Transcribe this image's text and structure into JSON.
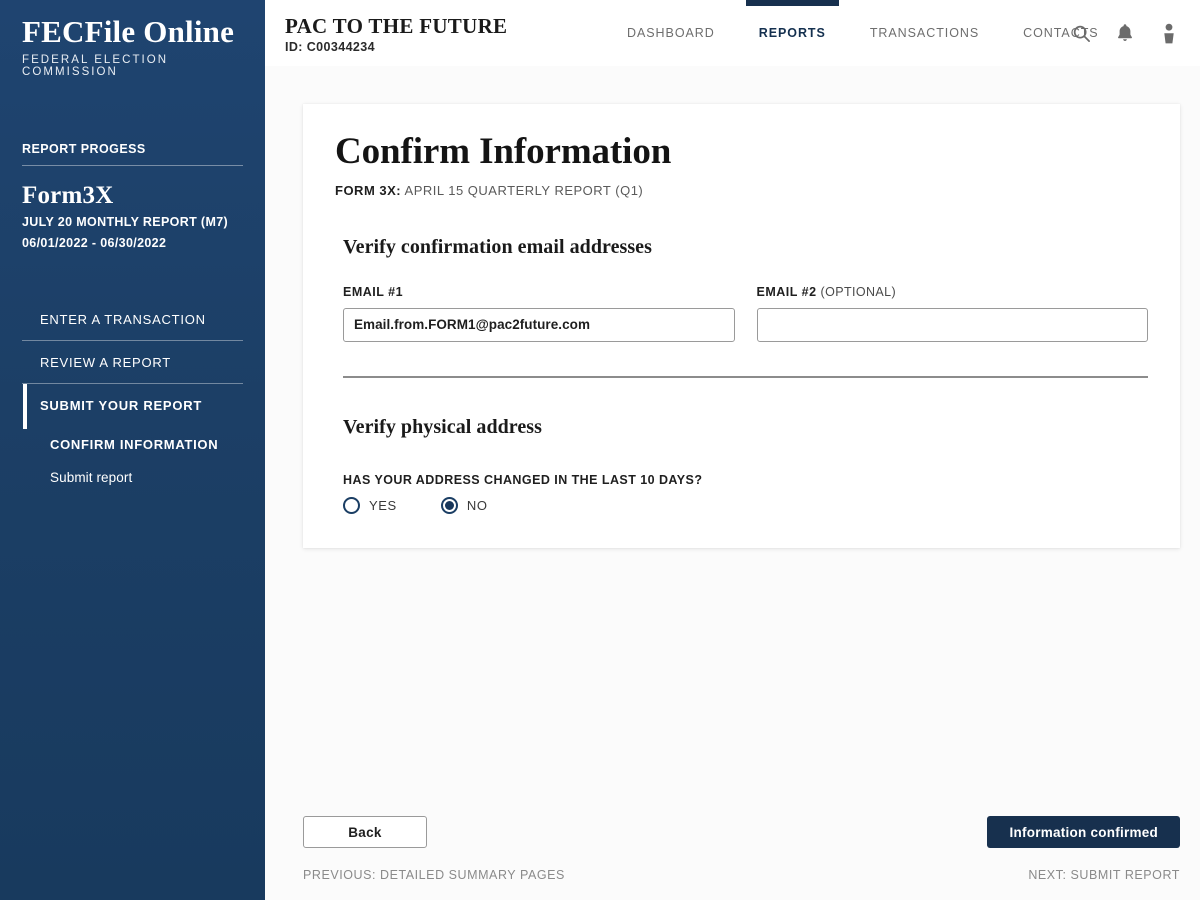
{
  "sidebar": {
    "brand": {
      "title": "FECFile Online",
      "subtitle": "FEDERAL ELECTION COMMISSION"
    },
    "progress_label": "REPORT PROGESS",
    "form_name": "Form3X",
    "report_name": "JULY 20 MONTHLY REPORT (M7)",
    "report_period": "06/01/2022 - 06/30/2022",
    "items": [
      {
        "label": "ENTER A TRANSACTION",
        "active": false
      },
      {
        "label": "REVIEW A REPORT",
        "active": false
      },
      {
        "label": "SUBMIT YOUR REPORT",
        "active": true
      }
    ],
    "subitems": [
      {
        "label": "CONFIRM INFORMATION",
        "current": true
      },
      {
        "label": "Submit report",
        "current": false
      }
    ]
  },
  "header": {
    "org_name": "PAC TO THE FUTURE",
    "org_id": "ID: C00344234",
    "nav": [
      {
        "label": "DASHBOARD",
        "active": false
      },
      {
        "label": "REPORTS",
        "active": true
      },
      {
        "label": "TRANSACTIONS",
        "active": false
      },
      {
        "label": "CONTACTS",
        "active": false
      }
    ],
    "icons": [
      {
        "name": "search-icon"
      },
      {
        "name": "notification-bell-icon"
      },
      {
        "name": "user-avatar-icon"
      }
    ]
  },
  "card": {
    "title": "Confirm Information",
    "subtitle_label": "FORM 3X:",
    "subtitle_value": "APRIL 15 QUARTERLY REPORT (Q1)",
    "email_section": {
      "heading": "Verify confirmation email addresses",
      "email1": {
        "label": "EMAIL #1",
        "value": "Email.from.FORM1@pac2future.com",
        "placeholder": ""
      },
      "email2": {
        "label": "EMAIL #2",
        "label_optional": "(OPTIONAL)",
        "value": "",
        "placeholder": ""
      }
    },
    "address_section": {
      "heading": "Verify physical address",
      "prompt": "HAS YOUR ADDRESS CHANGED IN THE LAST 10 DAYS?",
      "options": [
        {
          "label": "YES",
          "checked": false
        },
        {
          "label": "NO",
          "checked": true
        }
      ]
    }
  },
  "footer": {
    "back_label": "Back",
    "primary_label": "Information confirmed",
    "previous_link": "PREVIOUS: DETAILED SUMMARY PAGES",
    "next_link": "NEXT: SUBMIT REPORT"
  },
  "colors": {
    "sidebar_navy": "#1c3f66",
    "primary_navy": "#17304e",
    "accent_active": "#17304e",
    "page_bg": "#fbfbfb",
    "muted_text": "#8a8a8a"
  }
}
